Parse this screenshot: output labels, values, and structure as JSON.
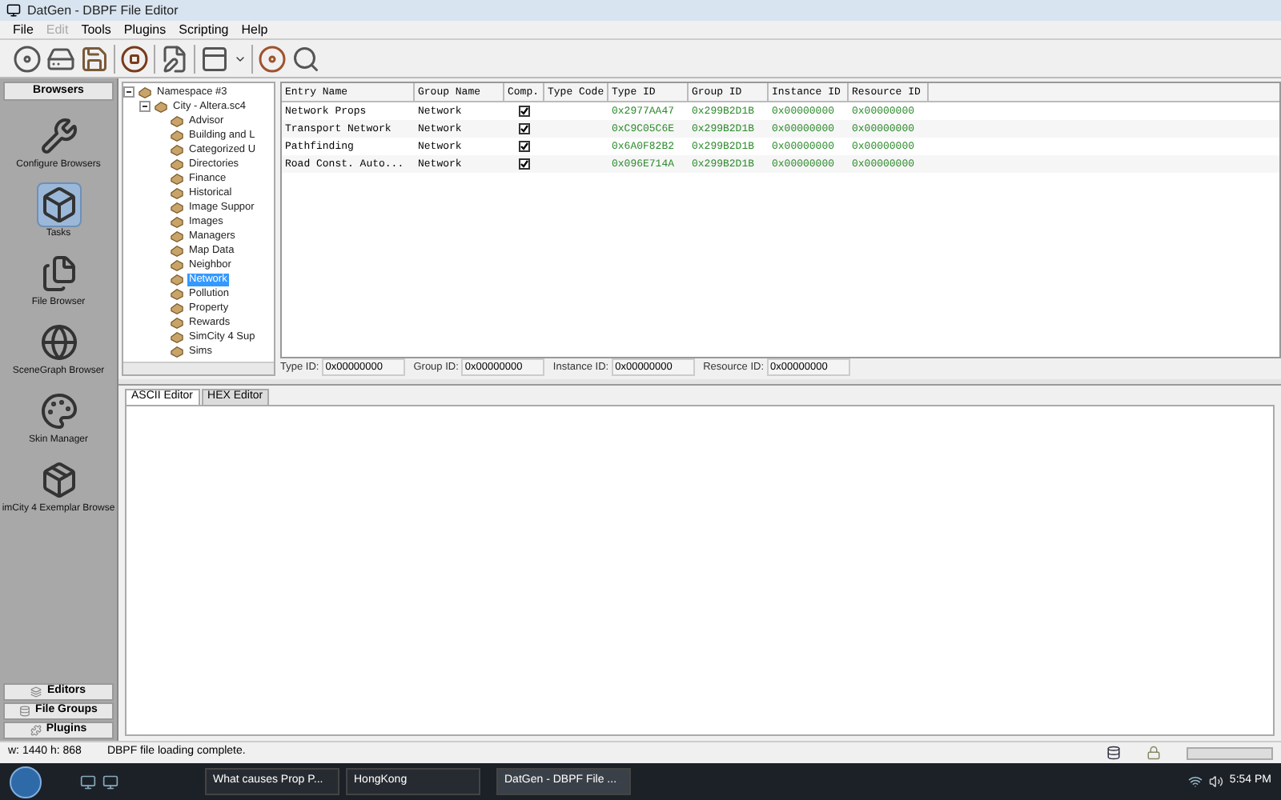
{
  "window": {
    "title": "DatGen - DBPF File Editor"
  },
  "menu": [
    {
      "label": "File",
      "disabled": false
    },
    {
      "label": "Edit",
      "disabled": true
    },
    {
      "label": "Tools",
      "disabled": false
    },
    {
      "label": "Plugins",
      "disabled": false
    },
    {
      "label": "Scripting",
      "disabled": false
    },
    {
      "label": "Help",
      "disabled": false
    }
  ],
  "sidebar": {
    "header": "Browsers",
    "items": [
      {
        "label": "Configure Browsers",
        "kind": "wrench",
        "selected": false
      },
      {
        "label": "Tasks",
        "kind": "box",
        "selected": true
      },
      {
        "label": "File Browser",
        "kind": "files",
        "selected": false
      },
      {
        "label": "SceneGraph Browser",
        "kind": "globe",
        "selected": false
      },
      {
        "label": "Skin Manager",
        "kind": "palette",
        "selected": false
      },
      {
        "label": "imCity 4 Exemplar Browse",
        "kind": "package",
        "selected": false
      }
    ],
    "sections": [
      "Editors",
      "File Groups",
      "Plugins"
    ]
  },
  "tree": [
    {
      "label": "Namespace #3",
      "expanded": true,
      "children": [
        {
          "label": "City - Altera.sc4",
          "expanded": true,
          "children": [
            {
              "label": "Advisor",
              "selected": false
            },
            {
              "label": "Building and L",
              "selected": false
            },
            {
              "label": "Categorized U",
              "selected": false
            },
            {
              "label": "Directories",
              "selected": false
            },
            {
              "label": "Finance",
              "selected": false
            },
            {
              "label": "Historical",
              "selected": false
            },
            {
              "label": "Image Suppor",
              "selected": false
            },
            {
              "label": "Images",
              "selected": false
            },
            {
              "label": "Managers",
              "selected": false
            },
            {
              "label": "Map Data",
              "selected": false
            },
            {
              "label": "Neighbor",
              "selected": false
            },
            {
              "label": "Network",
              "selected": true
            },
            {
              "label": "Pollution",
              "selected": false
            },
            {
              "label": "Property",
              "selected": false
            },
            {
              "label": "Rewards",
              "selected": false
            },
            {
              "label": "SimCity 4 Sup",
              "selected": false
            },
            {
              "label": "Sims",
              "selected": false
            }
          ]
        }
      ]
    }
  ],
  "table": {
    "columns": [
      "Entry Name",
      "Group Name",
      "Comp.",
      "Type Code",
      "Type ID",
      "Group ID",
      "Instance ID",
      "Resource ID"
    ],
    "rows": [
      {
        "entry": "Network Props",
        "group": "Network",
        "comp": true,
        "type_id": "0x2977AA47",
        "group_id": "0x299B2D1B",
        "instance_id": "0x00000000",
        "resource_id": "0x00000000"
      },
      {
        "entry": "Transport Network",
        "group": "Network",
        "comp": true,
        "type_id": "0xC9C05C6E",
        "group_id": "0x299B2D1B",
        "instance_id": "0x00000000",
        "resource_id": "0x00000000"
      },
      {
        "entry": "Pathfinding",
        "group": "Network",
        "comp": true,
        "type_id": "0x6A0F82B2",
        "group_id": "0x299B2D1B",
        "instance_id": "0x00000000",
        "resource_id": "0x00000000"
      },
      {
        "entry": "Road Const. Auto...",
        "group": "Network",
        "comp": true,
        "type_id": "0x096E714A",
        "group_id": "0x299B2D1B",
        "instance_id": "0x00000000",
        "resource_id": "0x00000000"
      }
    ]
  },
  "id_fields": [
    {
      "label": "Type ID:",
      "value": "0x00000000"
    },
    {
      "label": "Group ID:",
      "value": "0x00000000"
    },
    {
      "label": "Instance ID:",
      "value": "0x00000000"
    },
    {
      "label": "Resource ID:",
      "value": "0x00000000"
    }
  ],
  "editor_tabs": [
    {
      "label": "ASCII Editor",
      "selected": true
    },
    {
      "label": "HEX Editor",
      "selected": false
    }
  ],
  "status_bar": {
    "size": "w: 1440 h: 868",
    "message": "DBPF file loading complete.",
    "progress": {
      "level": 0
    }
  },
  "taskbar": {
    "tasks": [
      {
        "label": "What causes Prop P...",
        "selected": false
      },
      {
        "label": "HongKong",
        "selected": false
      },
      {
        "label": "DatGen - DBPF File ...",
        "selected": true
      }
    ],
    "clock": "5:54 PM"
  }
}
